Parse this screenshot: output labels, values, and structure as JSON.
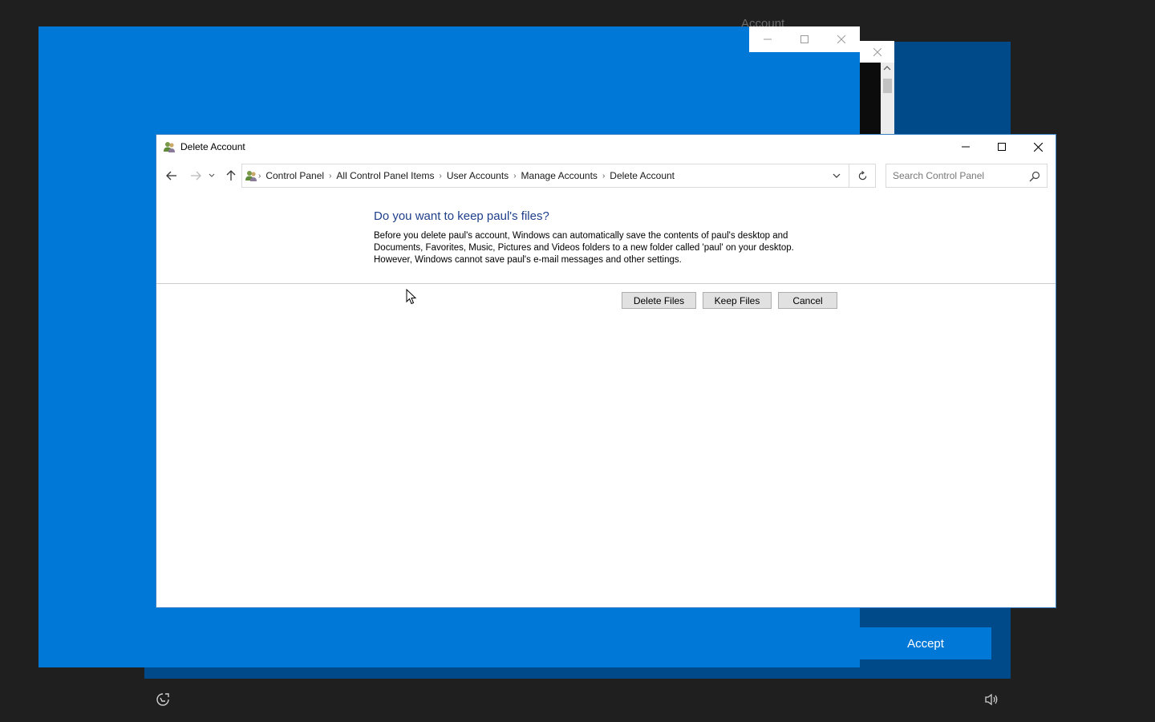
{
  "background": {
    "account_label": "Account",
    "accept_label": "Accept",
    "accent_color": "#0078d7"
  },
  "dialog": {
    "title": "Delete Account",
    "breadcrumbs": [
      "Control Panel",
      "All Control Panel Items",
      "User Accounts",
      "Manage Accounts",
      "Delete Account"
    ],
    "search_placeholder": "Search Control Panel",
    "heading": "Do you want to keep paul's files?",
    "description_lines": [
      "Before you delete paul's account, Windows can automatically save the contents of paul's desktop and",
      "Documents, Favorites, Music, Pictures and Videos folders to a new folder called 'paul' on your desktop.",
      "However, Windows cannot save paul's e-mail messages and other settings."
    ],
    "buttons": {
      "delete_files": "Delete Files",
      "keep_files": "Keep Files",
      "cancel": "Cancel"
    },
    "heading_color": "#1e3f8a"
  },
  "icons": [
    "user-accounts-icon",
    "back-arrow-icon",
    "forward-arrow-icon",
    "recent-locations-icon",
    "up-arrow-icon",
    "dropdown-chevron-icon",
    "refresh-icon",
    "search-icon",
    "minimize-icon",
    "maximize-icon",
    "close-icon",
    "accessibility-icon",
    "volume-icon",
    "mouse-cursor-icon"
  ]
}
